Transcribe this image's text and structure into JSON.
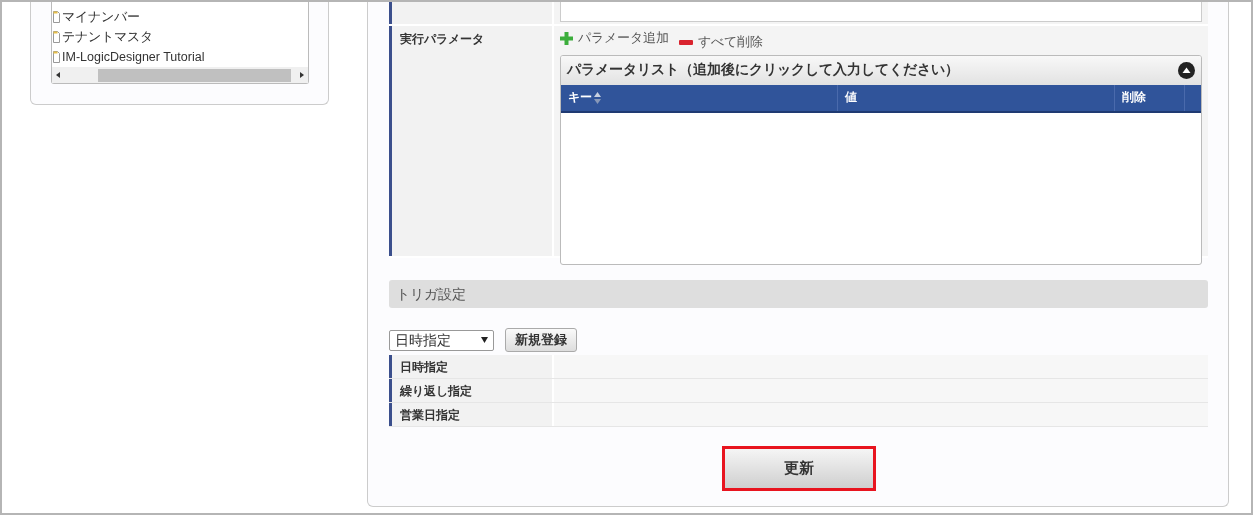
{
  "tree": {
    "items": [
      {
        "label": "マイナンバー"
      },
      {
        "label": "テナントマスタ"
      },
      {
        "label": "IM-LogicDesigner Tutorial"
      }
    ]
  },
  "parameters": {
    "label": "実行パラメータ",
    "toolbar": [
      {
        "kind": "add",
        "label": "パラメータ追加"
      },
      {
        "kind": "remove",
        "label": "すべて削除"
      }
    ],
    "grid": {
      "title": "パラメータリスト（追加後にクリックして入力してください）",
      "expanded": true,
      "columns": [
        {
          "label": "キー",
          "sortable": true
        },
        {
          "label": "値",
          "sortable": false
        },
        {
          "label": "削除",
          "sortable": false
        }
      ]
    }
  },
  "trigger": {
    "title": "トリガ設定",
    "select": {
      "value": "日時指定"
    },
    "add_button": "新規登録",
    "rows": [
      {
        "label": "日時指定"
      },
      {
        "label": "繰り返し指定"
      },
      {
        "label": "営業日指定"
      }
    ]
  },
  "submit": {
    "label": "更新",
    "highlighted": true
  }
}
